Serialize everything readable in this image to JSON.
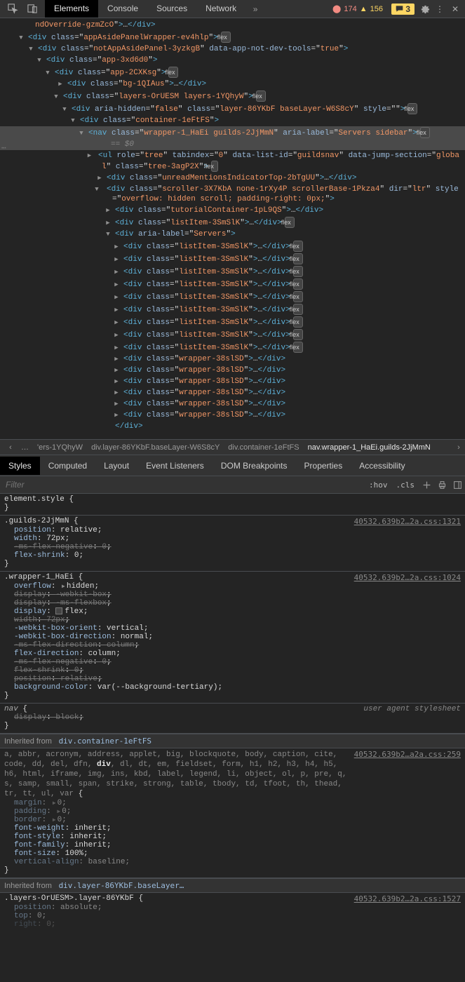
{
  "toolbar": {
    "tabs": [
      "Elements",
      "Console",
      "Sources",
      "Network"
    ],
    "active_tab": 0,
    "error_count": "174",
    "warning_count": "156",
    "chat_count": "3"
  },
  "tree": {
    "partial_top": "ndOverride-gzmZcO",
    "ellipsis": "…",
    "flex_label": "flex",
    "sel_marker": "== $0",
    "nodes": [
      {
        "indent": 40,
        "arrow": "open",
        "tag": "div",
        "attrs": [
          [
            "class",
            "appAsidePanelWrapper-ev4hlp"
          ]
        ],
        "badge": true
      },
      {
        "indent": 54,
        "arrow": "open",
        "tag": "div",
        "attrs": [
          [
            "class",
            "notAppAsidePanel-3yzkgB"
          ],
          [
            "data-app-not-dev-tools",
            "true"
          ]
        ]
      },
      {
        "indent": 66,
        "arrow": "open",
        "tag": "div",
        "attrs": [
          [
            "class",
            "app-3xd6d0"
          ]
        ]
      },
      {
        "indent": 78,
        "arrow": "open",
        "tag": "div",
        "attrs": [
          [
            "class",
            "app-2CXKsg"
          ]
        ],
        "badge": true
      },
      {
        "indent": 96,
        "arrow": "closed",
        "tag": "div",
        "attrs": [
          [
            "class",
            "bg-1QIAus"
          ]
        ],
        "selfclose_ellipsis": true
      },
      {
        "indent": 90,
        "arrow": "open",
        "tag": "div",
        "attrs": [
          [
            "class",
            "layers-OrUESM layers-1YQhyW"
          ]
        ],
        "badge": true
      },
      {
        "indent": 102,
        "arrow": "open",
        "tag": "div",
        "attrs": [
          [
            "aria-hidden",
            "false"
          ],
          [
            "class",
            "layer-86YKbF baseLayer-W6S8cY"
          ],
          [
            "style",
            ""
          ]
        ],
        "badge": true
      },
      {
        "indent": 114,
        "arrow": "open",
        "tag": "div",
        "attrs": [
          [
            "class",
            "container-1eFtFS"
          ]
        ]
      },
      {
        "indent": 126,
        "arrow": "open",
        "tag": "nav",
        "attrs": [
          [
            "class",
            "wrapper-1_HaEi guilds-2JjMmN"
          ],
          [
            "aria-label",
            "Servers sidebar"
          ]
        ],
        "badge": true,
        "selected": true
      },
      {
        "indent": 140,
        "arrow": "closed",
        "tag": "ul",
        "attrs": [
          [
            "role",
            "tree"
          ],
          [
            "tabindex",
            "0"
          ],
          [
            "data-list-id",
            "guildsnav"
          ],
          [
            "data-jump-section",
            "global"
          ],
          [
            "class",
            "tree-3agP2X"
          ]
        ],
        "badge": true,
        "wrap_indent": 145
      },
      {
        "indent": 152,
        "arrow": "closed",
        "tag": "div",
        "attrs": [
          [
            "class",
            "unreadMentionsIndicatorTop-2bTgUU"
          ]
        ],
        "selfclose_ellipsis": true
      },
      {
        "indent": 152,
        "arrow": "open",
        "tag": "div",
        "attrs": [
          [
            "class",
            "scroller-3X7KbA none-1rXy4P scrollerBase-1Pkza4"
          ],
          [
            "dir",
            "ltr"
          ],
          [
            "style",
            "overflow: hidden scroll; padding-right: 0px;"
          ]
        ],
        "wrap_indent": 160
      },
      {
        "indent": 164,
        "arrow": "closed",
        "tag": "div",
        "attrs": [
          [
            "class",
            "tutorialContainer-1pL9QS"
          ]
        ],
        "selfclose_ellipsis": true
      },
      {
        "indent": 164,
        "arrow": "closed",
        "tag": "div",
        "attrs": [
          [
            "class",
            "listItem-3SmSlK"
          ]
        ],
        "selfclose_ellipsis": true,
        "badge": true
      },
      {
        "indent": 164,
        "arrow": "open",
        "tag": "div",
        "attrs": [
          [
            "aria-label",
            "Servers"
          ]
        ]
      },
      {
        "indent": 176,
        "arrow": "closed",
        "tag": "div",
        "attrs": [
          [
            "class",
            "listItem-3SmSlK"
          ]
        ],
        "selfclose_ellipsis": true,
        "badge": true
      },
      {
        "indent": 176,
        "arrow": "closed",
        "tag": "div",
        "attrs": [
          [
            "class",
            "listItem-3SmSlK"
          ]
        ],
        "selfclose_ellipsis": true,
        "badge": true
      },
      {
        "indent": 176,
        "arrow": "closed",
        "tag": "div",
        "attrs": [
          [
            "class",
            "listItem-3SmSlK"
          ]
        ],
        "selfclose_ellipsis": true,
        "badge": true
      },
      {
        "indent": 176,
        "arrow": "closed",
        "tag": "div",
        "attrs": [
          [
            "class",
            "listItem-3SmSlK"
          ]
        ],
        "selfclose_ellipsis": true,
        "badge": true
      },
      {
        "indent": 176,
        "arrow": "closed",
        "tag": "div",
        "attrs": [
          [
            "class",
            "listItem-3SmSlK"
          ]
        ],
        "selfclose_ellipsis": true,
        "badge": true
      },
      {
        "indent": 176,
        "arrow": "closed",
        "tag": "div",
        "attrs": [
          [
            "class",
            "listItem-3SmSlK"
          ]
        ],
        "selfclose_ellipsis": true,
        "badge": true
      },
      {
        "indent": 176,
        "arrow": "closed",
        "tag": "div",
        "attrs": [
          [
            "class",
            "listItem-3SmSlK"
          ]
        ],
        "selfclose_ellipsis": true,
        "badge": true
      },
      {
        "indent": 176,
        "arrow": "closed",
        "tag": "div",
        "attrs": [
          [
            "class",
            "listItem-3SmSlK"
          ]
        ],
        "selfclose_ellipsis": true,
        "badge": true
      },
      {
        "indent": 176,
        "arrow": "closed",
        "tag": "div",
        "attrs": [
          [
            "class",
            "listItem-3SmSlK"
          ]
        ],
        "selfclose_ellipsis": true,
        "badge": true
      },
      {
        "indent": 176,
        "arrow": "closed",
        "tag": "div",
        "attrs": [
          [
            "class",
            "wrapper-38slSD"
          ]
        ],
        "selfclose_ellipsis": true
      },
      {
        "indent": 176,
        "arrow": "closed",
        "tag": "div",
        "attrs": [
          [
            "class",
            "wrapper-38slSD"
          ]
        ],
        "selfclose_ellipsis": true
      },
      {
        "indent": 176,
        "arrow": "closed",
        "tag": "div",
        "attrs": [
          [
            "class",
            "wrapper-38slSD"
          ]
        ],
        "selfclose_ellipsis": true
      },
      {
        "indent": 176,
        "arrow": "closed",
        "tag": "div",
        "attrs": [
          [
            "class",
            "wrapper-38slSD"
          ]
        ],
        "selfclose_ellipsis": true
      },
      {
        "indent": 176,
        "arrow": "closed",
        "tag": "div",
        "attrs": [
          [
            "class",
            "wrapper-38slSD"
          ]
        ],
        "selfclose_ellipsis": true
      },
      {
        "indent": 176,
        "arrow": "closed",
        "tag": "div",
        "attrs": [
          [
            "class",
            "wrapper-38slSD"
          ]
        ],
        "selfclose_ellipsis": true
      },
      {
        "indent": 164,
        "close": "div"
      }
    ]
  },
  "breadcrumb": {
    "items": [
      "…",
      "'ers-1YQhyW",
      "div.layer-86YKbF.baseLayer-W6S8cY",
      "div.container-1eFtFS",
      "nav.wrapper-1_HaEi.guilds-2JjMmN"
    ],
    "active": 4
  },
  "lower_tabs": {
    "items": [
      "Styles",
      "Computed",
      "Layout",
      "Event Listeners",
      "DOM Breakpoints",
      "Properties",
      "Accessibility"
    ],
    "active": 0
  },
  "filter": {
    "placeholder": "Filter",
    "hov": ":hov",
    "cls": ".cls"
  },
  "styles": {
    "element_style_label": "element.style",
    "rules": [
      {
        "selector": ".guilds-2JjMmN",
        "source": "40532.639b2…2a.css:1321",
        "decls": [
          {
            "prop": "position",
            "val": "relative"
          },
          {
            "prop": "width",
            "val": "72px"
          },
          {
            "prop": "-ms-flex-negative",
            "val": "0",
            "strike": true
          },
          {
            "prop": "flex-shrink",
            "val": "0"
          }
        ]
      },
      {
        "selector": ".wrapper-1_HaEi",
        "source": "40532.639b2…2a.css:1024",
        "decls": [
          {
            "prop": "overflow",
            "val": "hidden",
            "arrow": true
          },
          {
            "prop": "display",
            "val": "-webkit-box",
            "strike": true
          },
          {
            "prop": "display",
            "val": "-ms-flexbox",
            "strike": true
          },
          {
            "prop": "display",
            "val": "flex",
            "swatch": true
          },
          {
            "prop": "width",
            "val": "72px",
            "strike": true
          },
          {
            "prop": "-webkit-box-orient",
            "val": "vertical"
          },
          {
            "prop": "-webkit-box-direction",
            "val": "normal"
          },
          {
            "prop": "-ms-flex-direction",
            "val": "column",
            "strike": true
          },
          {
            "prop": "flex-direction",
            "val": "column"
          },
          {
            "prop": "-ms-flex-negative",
            "val": "0",
            "strike": true
          },
          {
            "prop": "flex-shrink",
            "val": "0",
            "strike": true
          },
          {
            "prop": "position",
            "val": "relative",
            "strike": true
          },
          {
            "prop": "background-color",
            "val": "var(--background-tertiary)"
          }
        ]
      },
      {
        "selector": "nav",
        "italic": true,
        "ua_sheet": "user agent stylesheet",
        "decls": [
          {
            "prop": "display",
            "val": "block",
            "strike": true
          }
        ]
      }
    ],
    "inherited1_label": "Inherited from",
    "inherited1_sel": "div.container-1eFtFS",
    "inherited_tags": "a, abbr, acronym, address, applet, big, blockquote, body, caption, cite, code, dd, del, dfn, div, dl, dt, em, fieldset, form, h1, h2, h3, h4, h5, h6, html, iframe, img, ins, kbd, label, legend, li, object, ol, p, pre, q, s, samp, small, span, strike, strong, table, tbody, td, tfoot, th, thead, tr, tt, ul, var",
    "inherited_source": "40532.639b2…a2a.css:259",
    "inherited_decls": [
      {
        "prop": "margin",
        "val": "0",
        "arrow": true,
        "dim": true
      },
      {
        "prop": "padding",
        "val": "0",
        "arrow": true,
        "dim": true
      },
      {
        "prop": "border",
        "val": "0",
        "arrow": true,
        "dim": true
      },
      {
        "prop": "font-weight",
        "val": "inherit"
      },
      {
        "prop": "font-style",
        "val": "inherit"
      },
      {
        "prop": "font-family",
        "val": "inherit"
      },
      {
        "prop": "font-size",
        "val": "100%"
      },
      {
        "prop": "vertical-align",
        "val": "baseline",
        "dim": true
      }
    ],
    "inherited2_label": "Inherited from",
    "inherited2_sel": "div.layer-86YKbF.baseLayer…",
    "rule3_selector": ".layers-OrUESM>.layer-86YKbF",
    "rule3_source": "40532.639b2…2a.css:1527",
    "rule3_decls": [
      {
        "prop": "position",
        "val": "absolute",
        "dim": true
      },
      {
        "prop": "top",
        "val": "0",
        "dim": true
      },
      {
        "prop": "right",
        "val": "0",
        "dim": true,
        "partial": true
      }
    ]
  }
}
